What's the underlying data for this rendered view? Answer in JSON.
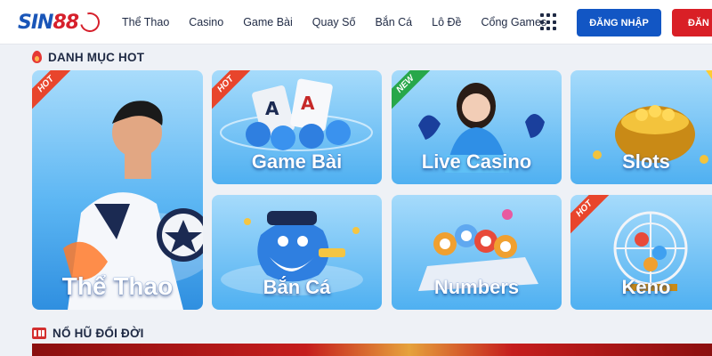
{
  "brand": {
    "logo_main": "SIN",
    "logo_num": "88"
  },
  "nav": {
    "items": [
      {
        "label": "Thể Thao"
      },
      {
        "label": "Casino"
      },
      {
        "label": "Game Bài"
      },
      {
        "label": "Quay Số"
      },
      {
        "label": "Bắn Cá"
      },
      {
        "label": "Lô Đề"
      },
      {
        "label": "Cổng Games"
      }
    ]
  },
  "auth": {
    "login_label": "ĐĂNG NHẬP",
    "register_label": "ĐĂN"
  },
  "sections": {
    "hot": {
      "title": "DANH MỤC HOT",
      "icon": "flame-icon"
    },
    "jackpot": {
      "title": "NỔ HŨ ĐỔI ĐỜI",
      "icon": "slot-machine-icon"
    }
  },
  "cards": {
    "the_thao": {
      "label": "Thể Thao",
      "badge": "HOT"
    },
    "game_bai": {
      "label": "Game Bài",
      "badge": "HOT"
    },
    "live_casino": {
      "label": "Live Casino",
      "badge": "NEW"
    },
    "slots": {
      "label": "Slots"
    },
    "ban_ca": {
      "label": "Bắn Cá"
    },
    "numbers": {
      "label": "Numbers"
    },
    "keno": {
      "label": "Keno",
      "badge": "HOT"
    }
  },
  "colors": {
    "primary": "#1256c4",
    "danger": "#d91f26",
    "card_bg_top": "#8fd0f7",
    "card_bg_bottom": "#3fa3ee"
  }
}
